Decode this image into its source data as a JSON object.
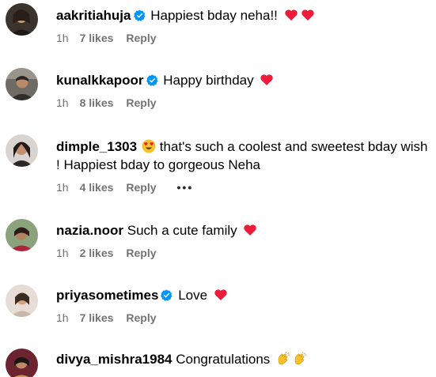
{
  "comments": [
    {
      "username": "aakritiahuja",
      "verified": true,
      "text": "Happiest bday neha!!",
      "emojis": [
        "red-heart",
        "red-heart"
      ],
      "time": "1h",
      "likes": "7 likes",
      "reply": "Reply"
    },
    {
      "username": "kunalkkapoor",
      "verified": true,
      "text": "Happy birthday",
      "emojis": [
        "red-heart"
      ],
      "time": "1h",
      "likes": "8 likes",
      "reply": "Reply"
    },
    {
      "username": "dimple_1303",
      "verified": false,
      "lead_emoji": "heart-eyes",
      "text": "that's such a coolest and sweetest bday wish ! Happiest bday to gorgeous Neha",
      "time": "1h",
      "likes": "4 likes",
      "reply": "Reply",
      "more": "•••"
    },
    {
      "username": "nazia.noor",
      "verified": false,
      "text": "Such a cute family",
      "emojis": [
        "red-heart"
      ],
      "time": "1h",
      "likes": "2 likes",
      "reply": "Reply"
    },
    {
      "username": "priyasometimes",
      "verified": true,
      "text": "Love",
      "emojis": [
        "red-heart"
      ],
      "time": "1h",
      "likes": "7 likes",
      "reply": "Reply"
    },
    {
      "username": "divya_mishra1984",
      "verified": false,
      "text": "Congratulations",
      "emojis": [
        "clapping-hands",
        "clapping-hands"
      ]
    }
  ],
  "colors": {
    "verified_badge": "#0095f6",
    "heart": "#ed1c3a",
    "meta_text": "#737373",
    "emoji_yellow": "#f8c22b"
  }
}
